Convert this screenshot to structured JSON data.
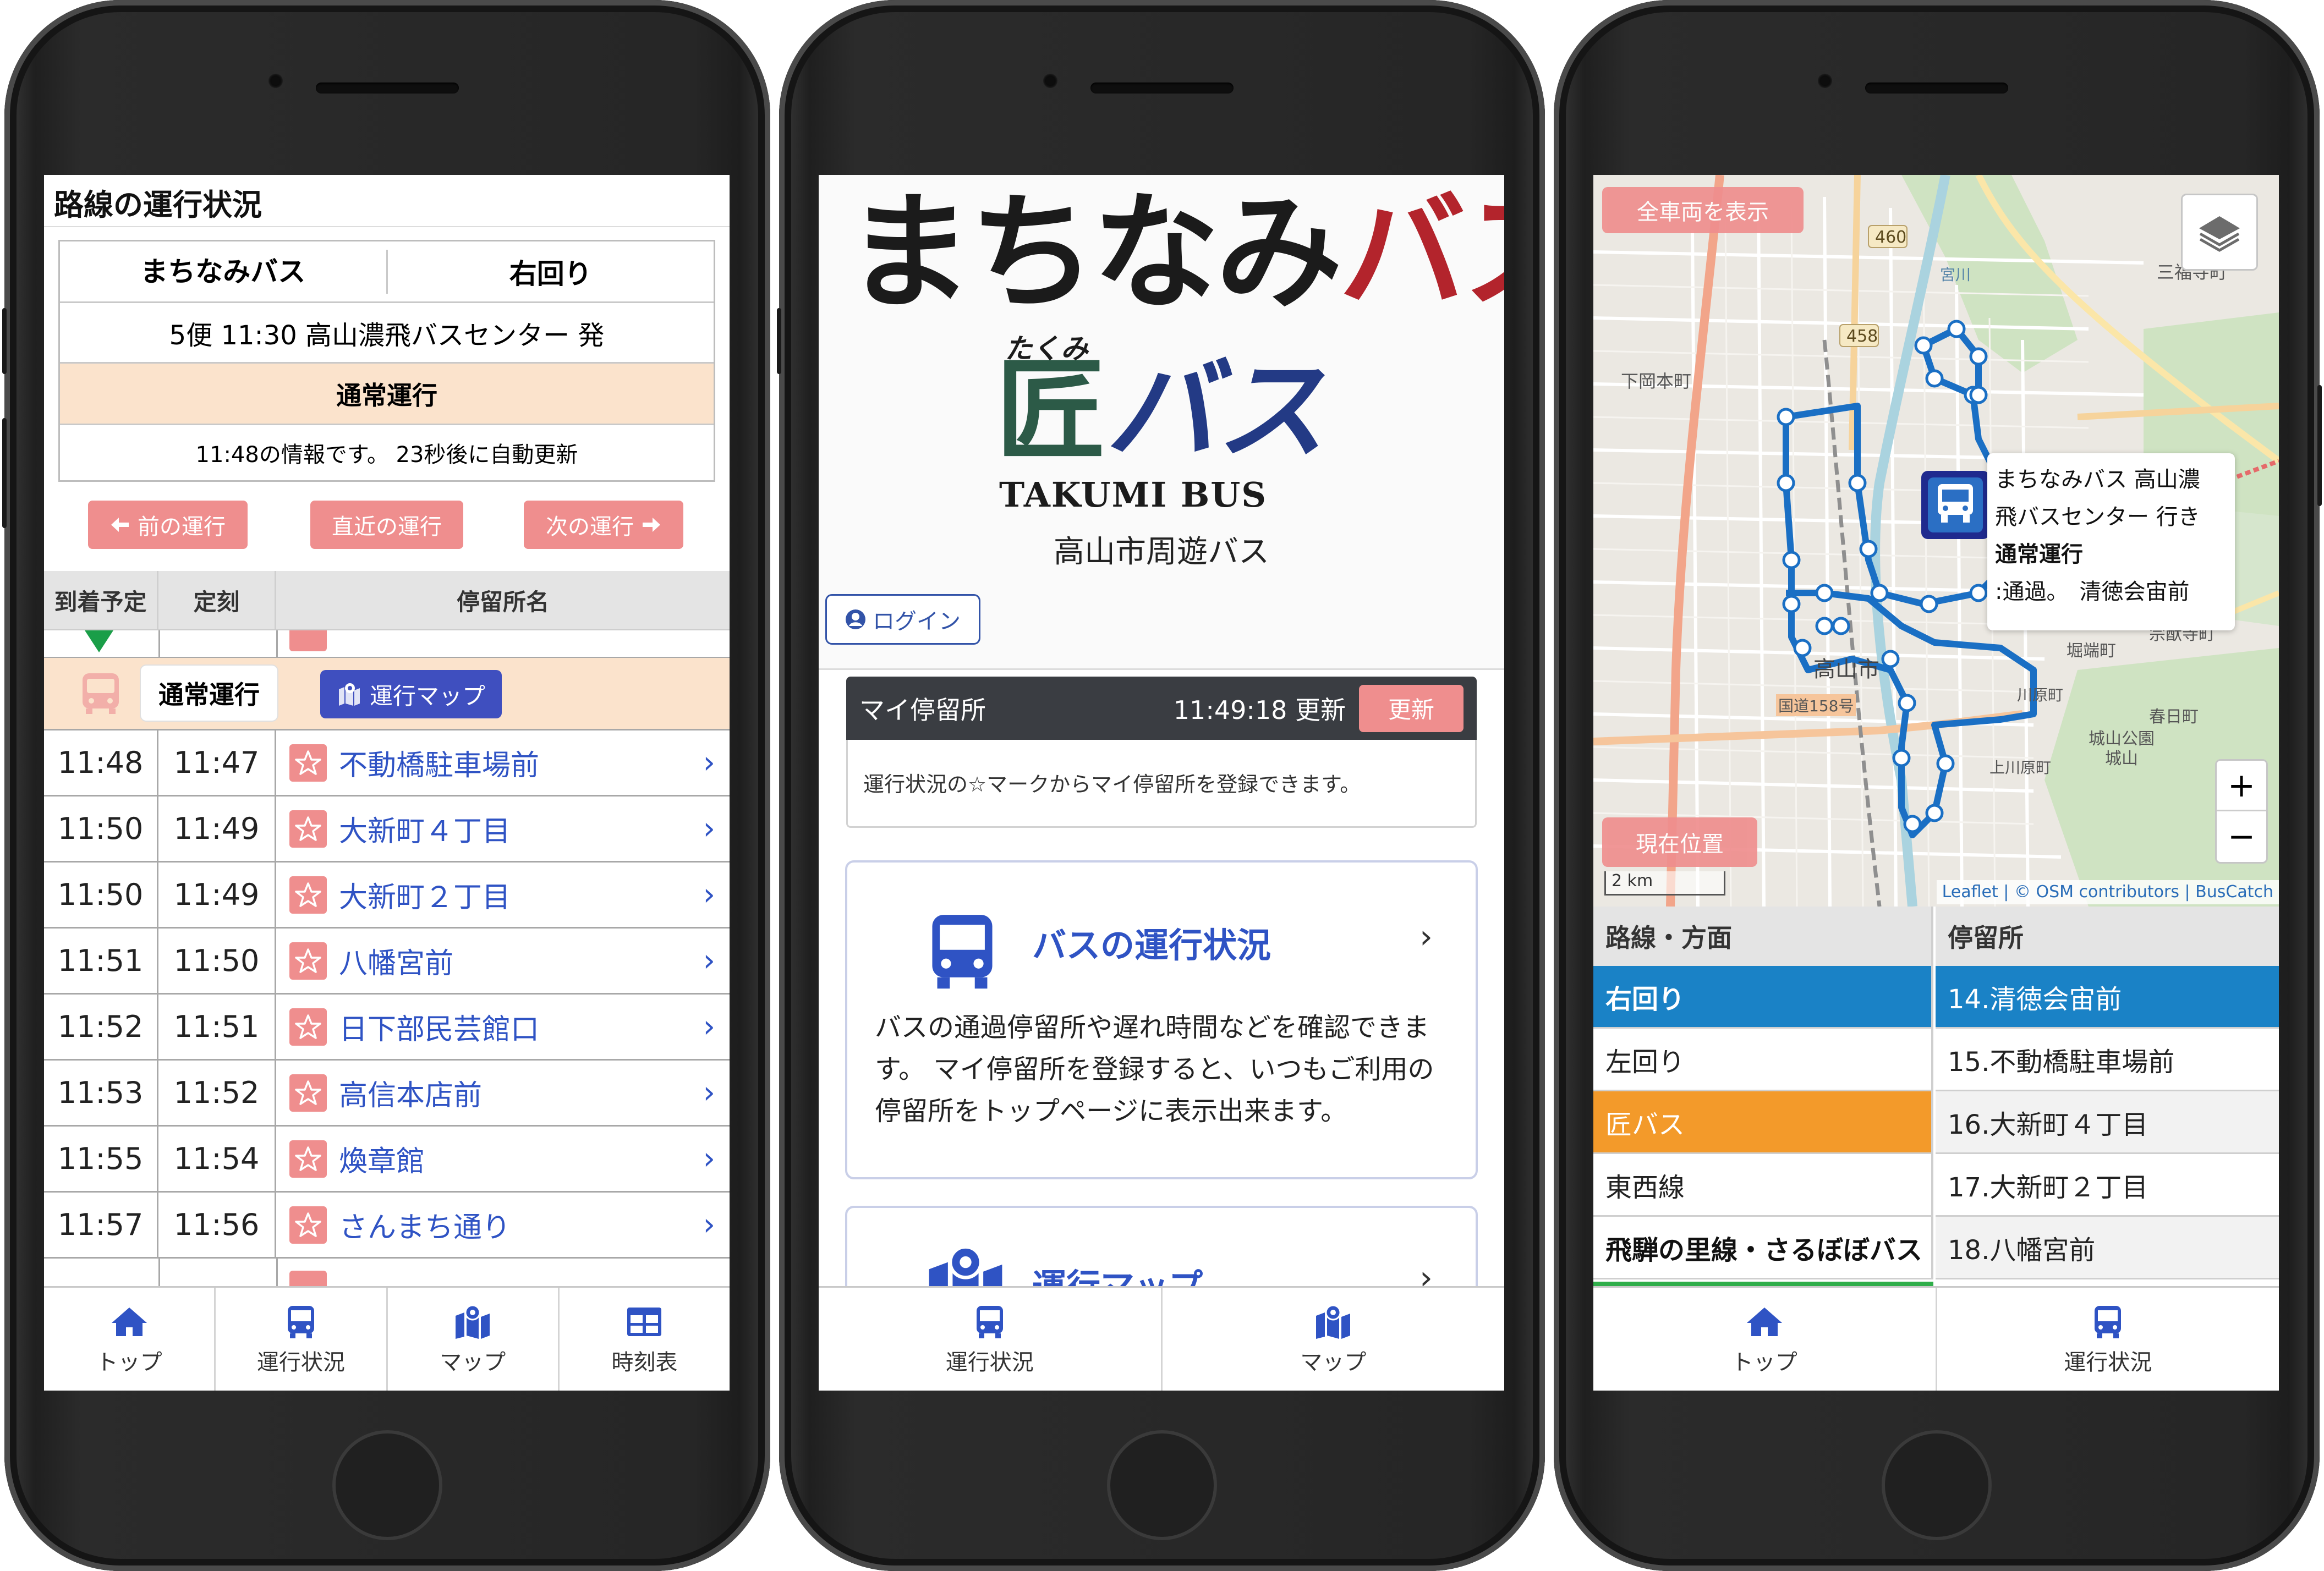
{
  "phone1": {
    "title": "路線の運行状況",
    "route_name": "まちなみバス",
    "direction": "右回り",
    "trip": "5便 11:30 高山濃飛バスセンター 発",
    "status": "通常運行",
    "update_info": "11:48の情報です。 23秒後に自動更新",
    "prev_label": "前の運行",
    "latest_label": "直近の運行",
    "next_label": "次の運行",
    "columns": [
      "到着予定",
      "定刻",
      "停留所名"
    ],
    "bus_status": "通常運行",
    "map_button": "運行マップ",
    "stops": [
      {
        "eta": "11:48",
        "sched": "11:47",
        "name": "不動橋駐車場前"
      },
      {
        "eta": "11:50",
        "sched": "11:49",
        "name": "大新町４丁目"
      },
      {
        "eta": "11:50",
        "sched": "11:49",
        "name": "大新町２丁目"
      },
      {
        "eta": "11:51",
        "sched": "11:50",
        "name": "八幡宮前"
      },
      {
        "eta": "11:52",
        "sched": "11:51",
        "name": "日下部民芸館口"
      },
      {
        "eta": "11:53",
        "sched": "11:52",
        "name": "高信本店前"
      },
      {
        "eta": "11:55",
        "sched": "11:54",
        "name": "煥章館"
      },
      {
        "eta": "11:57",
        "sched": "11:56",
        "name": "さんまち通り"
      }
    ],
    "nav": [
      "トップ",
      "運行状況",
      "マップ",
      "時刻表"
    ]
  },
  "phone2": {
    "logo_main": "まちなみバス",
    "logo_main_a": "まちなみ",
    "logo_main_b": "バス",
    "logo_ruby": "たくみ",
    "logo_sub_a": "匠",
    "logo_sub_b": "バス",
    "logo_en": "TAKUMI BUS",
    "site_sub": "高山市周遊バス",
    "login": "ログイン",
    "my_stop_title": "マイ停留所",
    "my_stop_time": "11:49:18 更新",
    "refresh": "更新",
    "my_stop_note": "運行状況の☆マークからマイ停留所を登録できます。",
    "card1_title": "バスの運行状況",
    "card1_desc": "バスの通過停留所や遅れ時間などを確認できます。 マイ停留所を登録すると、いつもご利用の停留所をトップページに表示出来ます。",
    "card2_title": "運行マップ",
    "nav": [
      "運行状況",
      "マップ"
    ]
  },
  "phone3": {
    "show_all": "全車両を表示",
    "current_location": "現在位置",
    "zoom_in": "+",
    "zoom_out": "−",
    "scale": "2 km",
    "attribution": "Leaflet | © OSM contributors | BusCatch",
    "popup_line1": "まちなみバス 高山濃",
    "popup_line2": "飛バスセンター 行き",
    "popup_status": "通常運行",
    "popup_passed": ":通過。　清徳会宙前",
    "map_labels": {
      "road460": "460",
      "road458": "458",
      "mitsufuku": "三福寺町",
      "shimookamoto": "下岡本町",
      "takayama": "高山市",
      "route158": "国道158号",
      "shiroyama_park": "城山公園",
      "shiroyama": "城山",
      "kasuga": "春日町",
      "sotoku": "宗猷寺町",
      "horibata": "堀端町",
      "kawara": "川原町",
      "miyagawa": "宮川",
      "kamijo": "上川原町"
    },
    "col_route": "路線・方面",
    "col_stop": "停留所",
    "routes": [
      {
        "name": "右回り",
        "bg": "#1a82c6",
        "fg": "#ffffff",
        "bold": true
      },
      {
        "name": "左回り",
        "bg": "#ffffff",
        "fg": "#222222",
        "bold": false
      },
      {
        "name": "匠バス",
        "bg": "#f39a2a",
        "fg": "#ffffff",
        "bold": false
      },
      {
        "name": "東西線",
        "bg": "#ffffff",
        "fg": "#222222",
        "bold": false
      },
      {
        "name": "飛騨の里線・さるぼぼバス",
        "bg": "#ffffff",
        "fg": "#111111",
        "bold": true
      }
    ],
    "stops": [
      {
        "name": "14.清徳会宙前",
        "bg": "#1a82c6",
        "fg": "#ffffff"
      },
      {
        "name": "15.不動橋駐車場前",
        "bg": "#ffffff",
        "fg": "#222222"
      },
      {
        "name": "16.大新町４丁目",
        "bg": "#f2f2f2",
        "fg": "#222222"
      },
      {
        "name": "17.大新町２丁目",
        "bg": "#ffffff",
        "fg": "#222222"
      },
      {
        "name": "18.八幡宮前",
        "bg": "#f2f2f2",
        "fg": "#222222"
      }
    ],
    "nav": [
      "トップ",
      "運行状況"
    ]
  },
  "colors": {
    "accent_pink": "#ef8e8e",
    "link_blue": "#2f53c4",
    "route_blue": "#1a82c6",
    "orange": "#f39a2a",
    "logo_red": "#b3242c",
    "logo_green": "#2c5a47"
  }
}
